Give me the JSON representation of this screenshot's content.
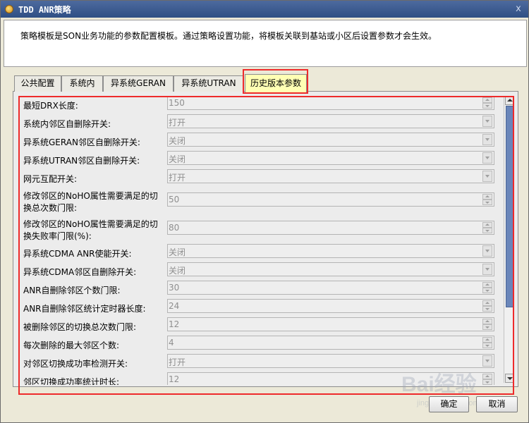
{
  "window": {
    "title": "TDD ANR策略",
    "close_glyph": "x"
  },
  "info": {
    "text": "策略模板是SON业务功能的参数配置模板。通过策略设置功能，将模板关联到基站或小区后设置参数才会生效。"
  },
  "tabs": [
    {
      "label": "公共配置",
      "active": false
    },
    {
      "label": "系统内",
      "active": false
    },
    {
      "label": "异系统GERAN",
      "active": false
    },
    {
      "label": "异系统UTRAN",
      "active": false
    },
    {
      "label": "历史版本参数",
      "active": true
    }
  ],
  "params": [
    {
      "label": "最短DRX长度:",
      "value": "150",
      "control": "spinner"
    },
    {
      "label": "系统内邻区自删除开关:",
      "value": "打开",
      "control": "dropdown"
    },
    {
      "label": "异系统GERAN邻区自删除开关:",
      "value": "关闭",
      "control": "dropdown"
    },
    {
      "label": "异系统UTRAN邻区自删除开关:",
      "value": "关闭",
      "control": "dropdown"
    },
    {
      "label": "网元互配开关:",
      "value": "打开",
      "control": "dropdown"
    },
    {
      "label": "修改邻区的NoHO属性需要满足的切换总次数门限:",
      "label_line1": "修改邻区的NoHO属性需要满足的切",
      "label_line2": "换总次数门限:",
      "value": "50",
      "control": "spinner"
    },
    {
      "label": "修改邻区的NoHO属性需要满足的切换失败率门限(%):",
      "label_line1": "修改邻区的NoHO属性需要满足的切",
      "label_line2": "换失败率门限(%):",
      "value": "80",
      "control": "spinner"
    },
    {
      "label": "异系统CDMA ANR使能开关:",
      "value": "关闭",
      "control": "dropdown"
    },
    {
      "label": "异系统CDMA邻区自删除开关:",
      "value": "关闭",
      "control": "dropdown"
    },
    {
      "label": "ANR自删除邻区个数门限:",
      "value": "30",
      "control": "spinner"
    },
    {
      "label": "ANR自删除邻区统计定时器长度:",
      "value": "24",
      "control": "spinner"
    },
    {
      "label": "被删除邻区的切换总次数门限:",
      "value": "12",
      "control": "spinner"
    },
    {
      "label": "每次删除的最大邻区个数:",
      "value": "4",
      "control": "spinner"
    },
    {
      "label": "对邻区切换成功率检测开关:",
      "value": "打开",
      "control": "dropdown"
    },
    {
      "label": "邻区切换成功率统计时长:",
      "value": "12",
      "control": "spinner"
    }
  ],
  "buttons": {
    "ok": "确定",
    "cancel": "取消"
  },
  "watermark": {
    "text": "Bai经验",
    "sub": "jingyan.baidu.com"
  },
  "colors": {
    "highlight": "#ee2b2b",
    "active_tab": "#ffffb4",
    "title_bar": "#3a5a8f",
    "scroll_thumb": "#6a86ba"
  }
}
